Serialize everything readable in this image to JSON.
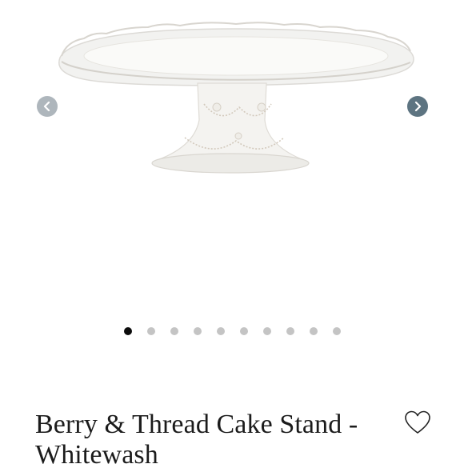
{
  "product": {
    "title": "Berry & Thread Cake Stand - Whitewash",
    "image_alt": "Berry & Thread Cake Stand - Whitewash"
  },
  "gallery": {
    "image_count": 10,
    "active_index": 0,
    "prev_icon": "chevron-left-icon",
    "next_icon": "chevron-right-icon"
  },
  "wishlist": {
    "icon": "heart-outline-icon"
  },
  "colors": {
    "arrow_inactive": "#aeb6bc",
    "arrow_active": "#5d7481",
    "dot_active": "#0c0c0c",
    "dot_inactive": "#c4c4c4",
    "title_text": "#1b1b1b"
  }
}
